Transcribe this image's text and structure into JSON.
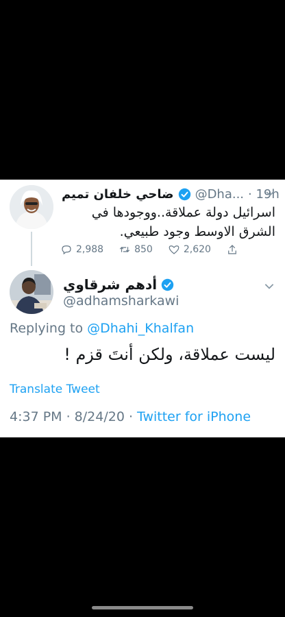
{
  "parent_tweet": {
    "name": "ضاحي خلفان تميم",
    "handle": "@Dha...",
    "time": "· 19h",
    "text": "اسرائيل دولة عملاقة..ووجودها في الشرق الاوسط وجود طبيعي.",
    "replies": "2,988",
    "retweets": "850",
    "likes": "2,620"
  },
  "main_tweet": {
    "name": "أدهم شرقاوي",
    "handle": "@adhamsharkawi",
    "replying_prefix": "Replying to",
    "replying_to": "@Dhahi_Khalfan",
    "text": "ليست عملاقة، ولكن أنتَ قزم !",
    "translate": "Translate Tweet",
    "timestamp": "4:37 PM · 8/24/20 ·",
    "source": "Twitter for iPhone"
  },
  "colors": {
    "accent": "#1da1f2",
    "muted": "#657786",
    "text": "#14171a",
    "background": "#000000"
  }
}
